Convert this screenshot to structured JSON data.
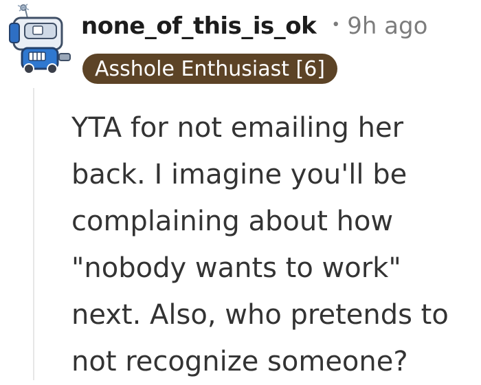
{
  "comment": {
    "author": "none_of_this_is_ok",
    "separator": "•",
    "time_ago": "9h ago",
    "flair": "Asshole Enthusiast [6]",
    "body_lines": [
      "YTA for not emailing her",
      "back. I imagine you'll be",
      "complaining about how",
      "\"nobody wants to work\"",
      "next. Also, who pretends to",
      "not recognize someone?"
    ]
  },
  "colors": {
    "flair_bg": "#5c4326",
    "meta_text": "#7c7c7c",
    "body_text": "#333333"
  },
  "icons": {
    "avatar": "robot-avatar-icon"
  }
}
